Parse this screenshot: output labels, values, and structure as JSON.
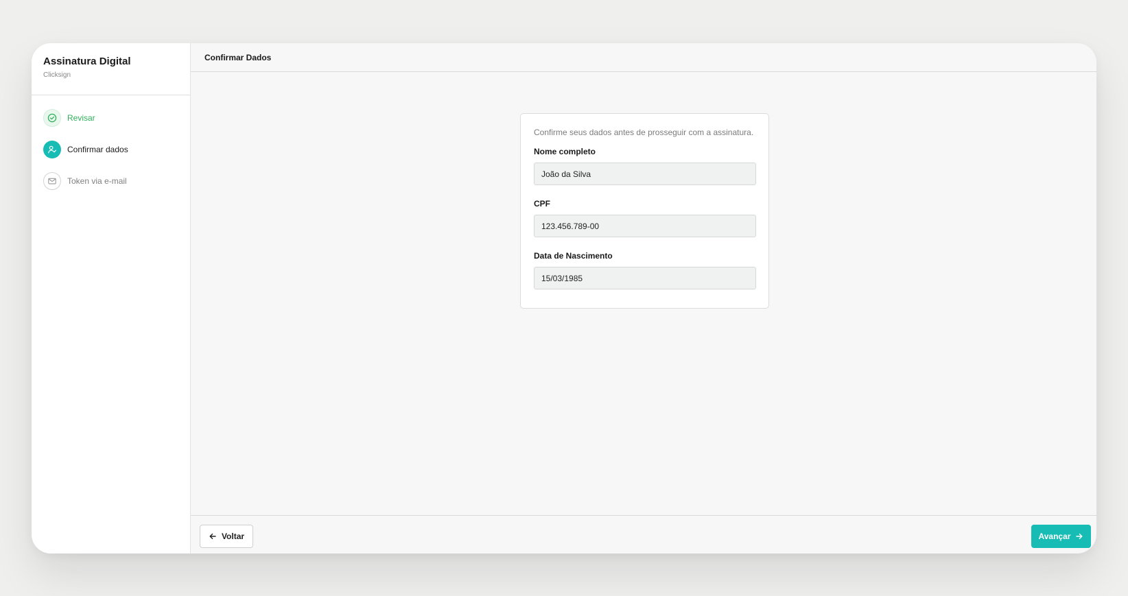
{
  "sidebar": {
    "title": "Assinatura Digital",
    "subtitle": "Clicksign",
    "steps": [
      {
        "label": "Revisar",
        "status": "done",
        "icon": "check-circle-icon"
      },
      {
        "label": "Confirmar dados",
        "status": "active",
        "icon": "user-check-icon"
      },
      {
        "label": "Token via e-mail",
        "status": "pending",
        "icon": "mail-icon"
      }
    ]
  },
  "header": {
    "title": "Confirmar Dados"
  },
  "form": {
    "intro": "Confirme seus dados antes de prosseguir com a assinatura.",
    "fields": [
      {
        "label": "Nome completo",
        "value": "João da Silva"
      },
      {
        "label": "CPF",
        "value": "123.456.789-00"
      },
      {
        "label": "Data de Nascimento",
        "value": "15/03/1985"
      }
    ]
  },
  "footer": {
    "back_label": "Voltar",
    "next_label": "Avançar"
  },
  "colors": {
    "accent": "#17bcb4",
    "success": "#2fb05c"
  }
}
